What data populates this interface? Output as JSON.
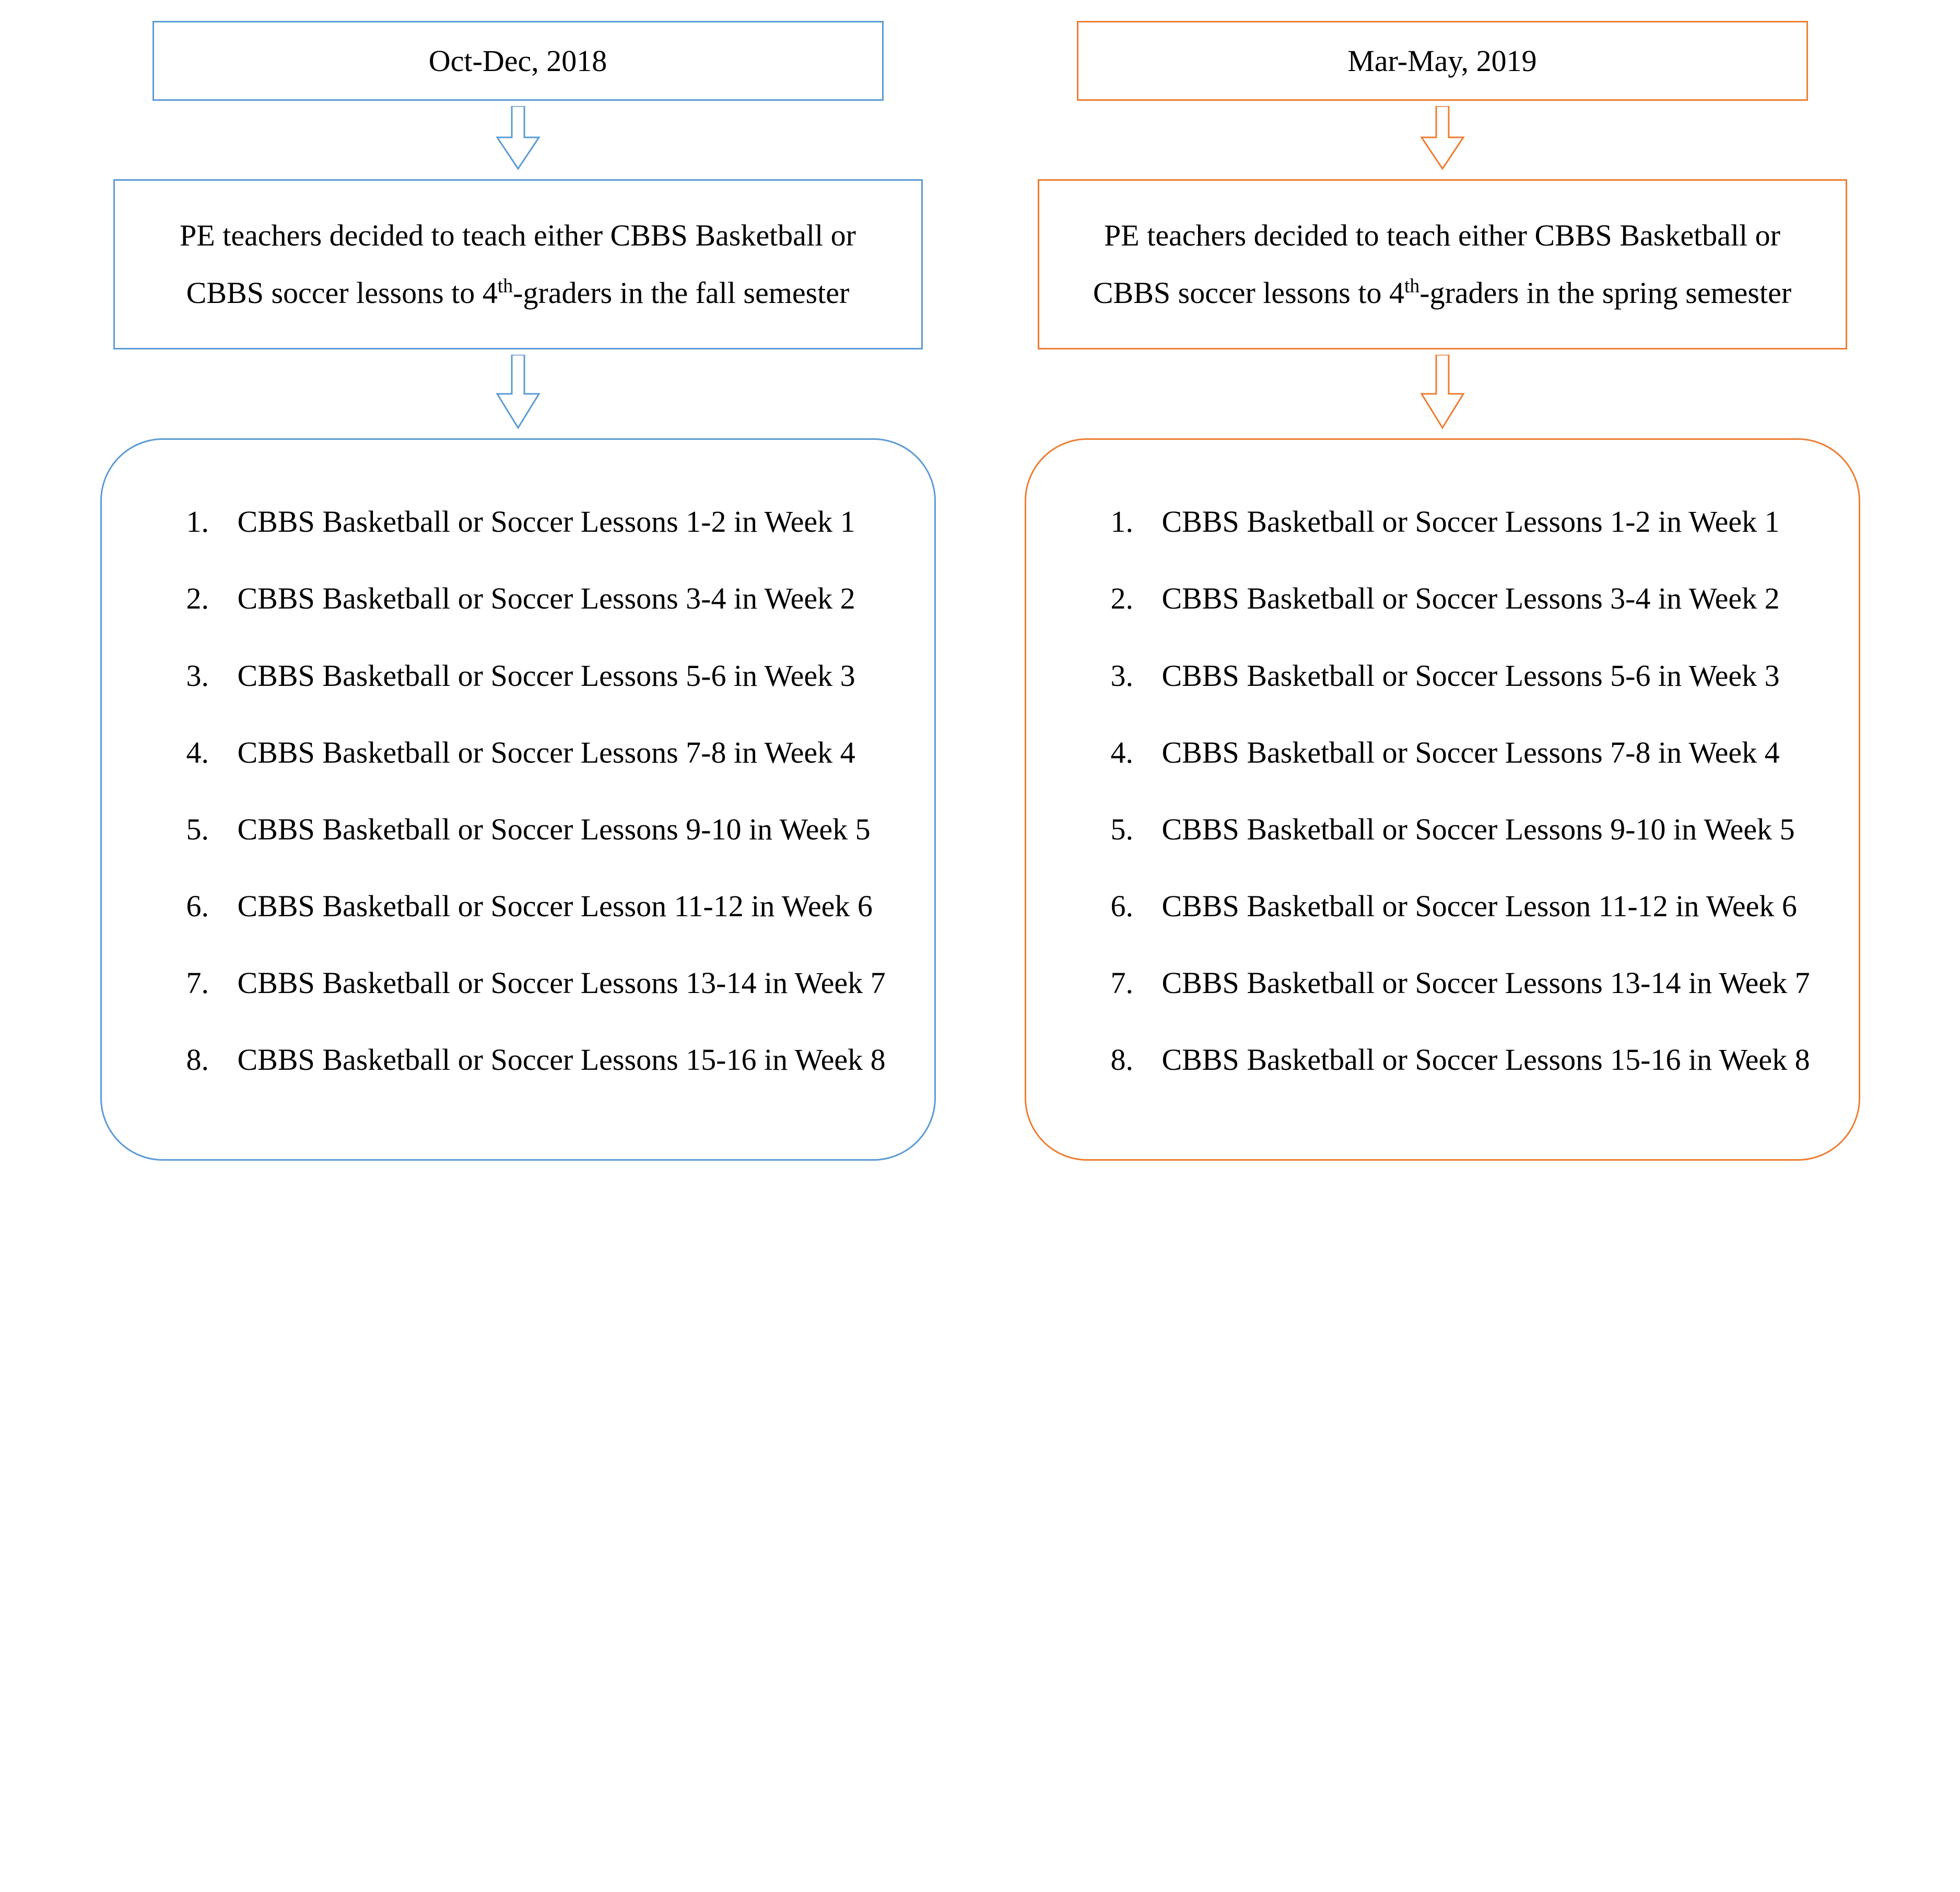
{
  "colors": {
    "blue": "#5b9bd5",
    "orange": "#ed7d31"
  },
  "left": {
    "date": "Oct-Dec, 2018",
    "desc_part1": "PE teachers decided to teach either CBBS Basketball or CBBS soccer lessons to 4",
    "desc_sup": "th",
    "desc_part2": "-graders in the fall semester",
    "lessons": [
      "CBBS Basketball or Soccer Lessons 1-2 in Week 1",
      "CBBS Basketball or Soccer Lessons 3-4 in Week 2",
      "CBBS Basketball or Soccer Lessons 5-6 in Week 3",
      "CBBS Basketball or Soccer Lessons 7-8 in Week 4",
      "CBBS Basketball or Soccer Lessons 9-10 in Week 5",
      "CBBS Basketball or Soccer Lesson 11-12 in Week 6",
      "CBBS Basketball or Soccer Lessons 13-14 in Week 7",
      "CBBS Basketball or Soccer Lessons 15-16 in Week 8"
    ]
  },
  "right": {
    "date": "Mar-May, 2019",
    "desc_part1": "PE teachers decided to teach either CBBS Basketball or CBBS soccer lessons to 4",
    "desc_sup": "th",
    "desc_part2": "-graders in the spring semester",
    "lessons": [
      "CBBS Basketball or Soccer Lessons 1-2 in Week 1",
      "CBBS Basketball or Soccer Lessons 3-4 in Week 2",
      "CBBS Basketball or Soccer Lessons 5-6 in Week 3",
      "CBBS Basketball or Soccer Lessons 7-8 in Week 4",
      "CBBS Basketball or Soccer Lessons 9-10 in Week 5",
      "CBBS Basketball or Soccer Lesson 11-12 in Week 6",
      "CBBS Basketball or Soccer Lessons 13-14 in Week 7",
      "CBBS Basketball or Soccer Lessons 15-16 in Week 8"
    ]
  }
}
